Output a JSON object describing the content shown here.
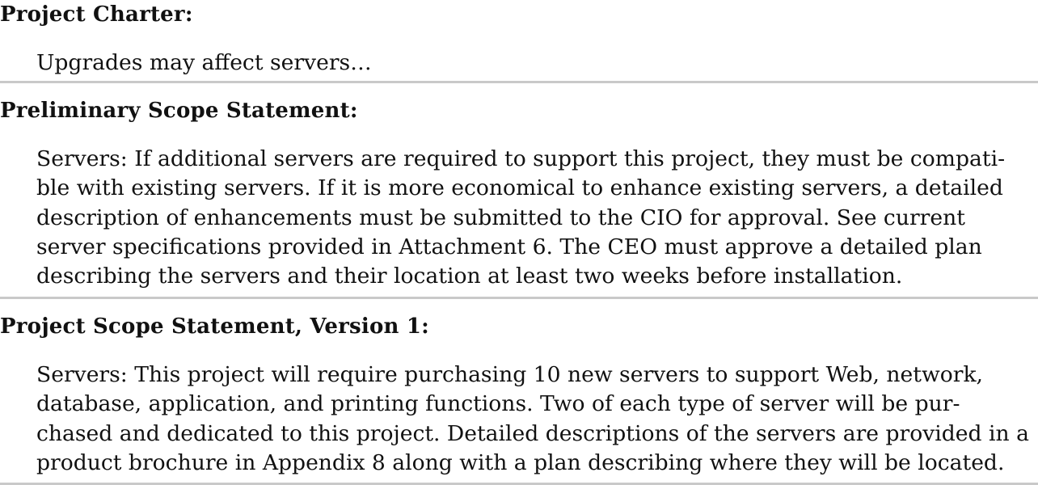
{
  "sections": [
    {
      "heading": "Project Charter:",
      "lines": [
        "Upgrades may affect servers…"
      ]
    },
    {
      "heading": "Preliminary Scope Statement:",
      "lines": [
        "Servers: If additional servers are required to support this project, they must be compati-",
        "ble with existing servers. If it is more economical to enhance existing servers, a detailed",
        "description of enhancements must be submitted to the CIO for approval. See current",
        "server specifications provided in Attachment 6. The CEO must approve a detailed plan",
        "describing the servers and their location at least two weeks before installation."
      ]
    },
    {
      "heading": "Project Scope Statement, Version 1:",
      "lines": [
        "Servers: This project will require purchasing 10 new servers to support Web, network,",
        "database, application, and printing functions. Two of each type of server will be pur-",
        "chased and dedicated to this project. Detailed descriptions of the servers are provided in a",
        "product brochure in Appendix 8 along with a plan describing where they will be located."
      ]
    }
  ]
}
